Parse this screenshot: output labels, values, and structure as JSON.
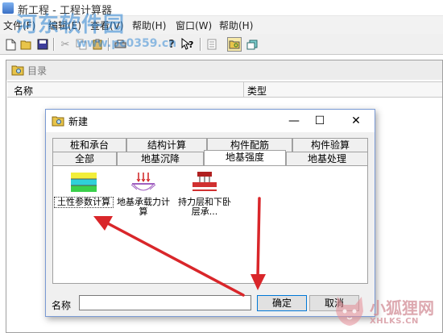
{
  "app": {
    "title": "新工程 - 工程计算器",
    "accent_color": "#3a6fc4"
  },
  "watermark": {
    "site_name": "河东软件园",
    "site_url": "www.pc0359.cn"
  },
  "menu": {
    "items": [
      "文件(F)",
      "编辑(E)",
      "查看(V)",
      "帮助(H)",
      "窗口(W)",
      "帮助(H)"
    ]
  },
  "toolbar": {
    "buttons": [
      "new-icon",
      "open-icon",
      "save-icon",
      "cut-icon",
      "copy-icon",
      "paste-icon",
      "print-icon",
      "help-icon",
      "context-help-icon",
      "report-icon",
      "open-folder-icon",
      "new-folder-icon"
    ],
    "help_glyph": "?",
    "context_help_glyph": "?"
  },
  "child_window": {
    "title": "目录",
    "columns": [
      "名称",
      "类型"
    ]
  },
  "dialog": {
    "title": "新建",
    "window_buttons": {
      "minimize": "—",
      "maximize": "☐",
      "close": "✕"
    },
    "tabs_back_row": [
      "桩和承台",
      "结构计算",
      "构件配筋",
      "构件验算"
    ],
    "tabs_front_row": [
      "全部",
      "地基沉降",
      "地基强度",
      "地基处理"
    ],
    "active_tab": "地基强度",
    "items": [
      {
        "label": "土性参数计算",
        "icon": "soil-layers-icon",
        "selected": true
      },
      {
        "label": "地基承载力计算",
        "icon": "bearing-capacity-icon",
        "selected": false
      },
      {
        "label": "持力层和下卧层承...",
        "icon": "bearing-layer-icon",
        "selected": false
      }
    ],
    "name_label": "名称",
    "name_value": "",
    "ok_button": "确定",
    "cancel_button": "取消"
  },
  "corner_watermark": {
    "name": "小狐狸网",
    "domain": "XHLKS.CN"
  },
  "colors": {
    "arrow": "#d9262a",
    "dialog_border": "#7a9ad4",
    "default_button_border": "#0078d7"
  }
}
